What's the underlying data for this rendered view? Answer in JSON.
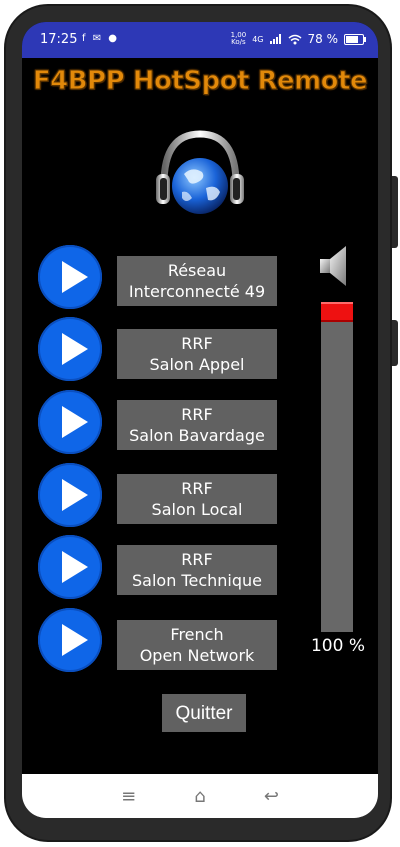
{
  "status": {
    "time": "17:25",
    "notifications": "f ✉ ●",
    "speed_value": "1,00",
    "speed_unit": "Ko/s",
    "network": "4G",
    "battery": "78 %"
  },
  "app": {
    "title": "F4BPP HotSpot Remote"
  },
  "stations": [
    {
      "line1": "Réseau",
      "line2": "Interconnecté 49"
    },
    {
      "line1": "RRF",
      "line2": "Salon Appel"
    },
    {
      "line1": "RRF",
      "line2": "Salon Bavardage"
    },
    {
      "line1": "RRF",
      "line2": "Salon Local"
    },
    {
      "line1": "RRF",
      "line2": "Salon Technique"
    },
    {
      "line1": "French",
      "line2": "Open Network"
    }
  ],
  "volume": {
    "level": 100,
    "label": "100 %"
  },
  "quit_label": "Quitter",
  "nav": {
    "menu_icon": "≡",
    "home_icon": "⌂",
    "back_icon": "↩"
  },
  "colors": {
    "status_bar": "#2d38b6",
    "play_button": "#0f66e8",
    "label_bg": "#616161",
    "title_orange": "#e2890a",
    "slider_thumb": "#ee1111"
  }
}
